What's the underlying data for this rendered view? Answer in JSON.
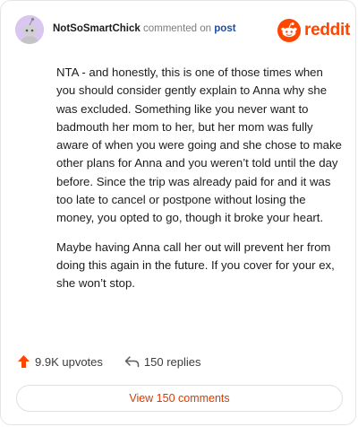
{
  "header": {
    "username": "NotSoSmartChick",
    "action_text": "commented on",
    "post_link": "post"
  },
  "logo": {
    "text": "reddit",
    "brand_color": "#ff4500",
    "icon": "reddit-snoo-icon"
  },
  "comment": {
    "paragraphs": [
      "NTA - and honestly, this is one of those times when you should consider gently explain to Anna why she was excluded. Something like you never want to badmouth her mom to her, but her mom was fully aware of when you were going and she chose to make other plans for Anna and you weren’t told until the day before. Since the trip was already paid for and it was too late to cancel or postpone without losing the money, you opted to go, though it broke your heart.",
      "Maybe having Anna call her out will prevent her from doing this again in the future. If you cover for your ex, she won’t stop."
    ]
  },
  "stats": {
    "upvotes": "9.9K upvotes",
    "upvote_icon": "upvote-arrow-icon",
    "upvote_color": "#ff4500",
    "replies": "150 replies",
    "reply_icon": "reply-arrow-icon"
  },
  "view_button": {
    "label": "View 150 comments",
    "color": "#d93a00"
  },
  "avatar": {
    "icon": "snoo-avatar-icon",
    "background": "#d9c7f2"
  }
}
